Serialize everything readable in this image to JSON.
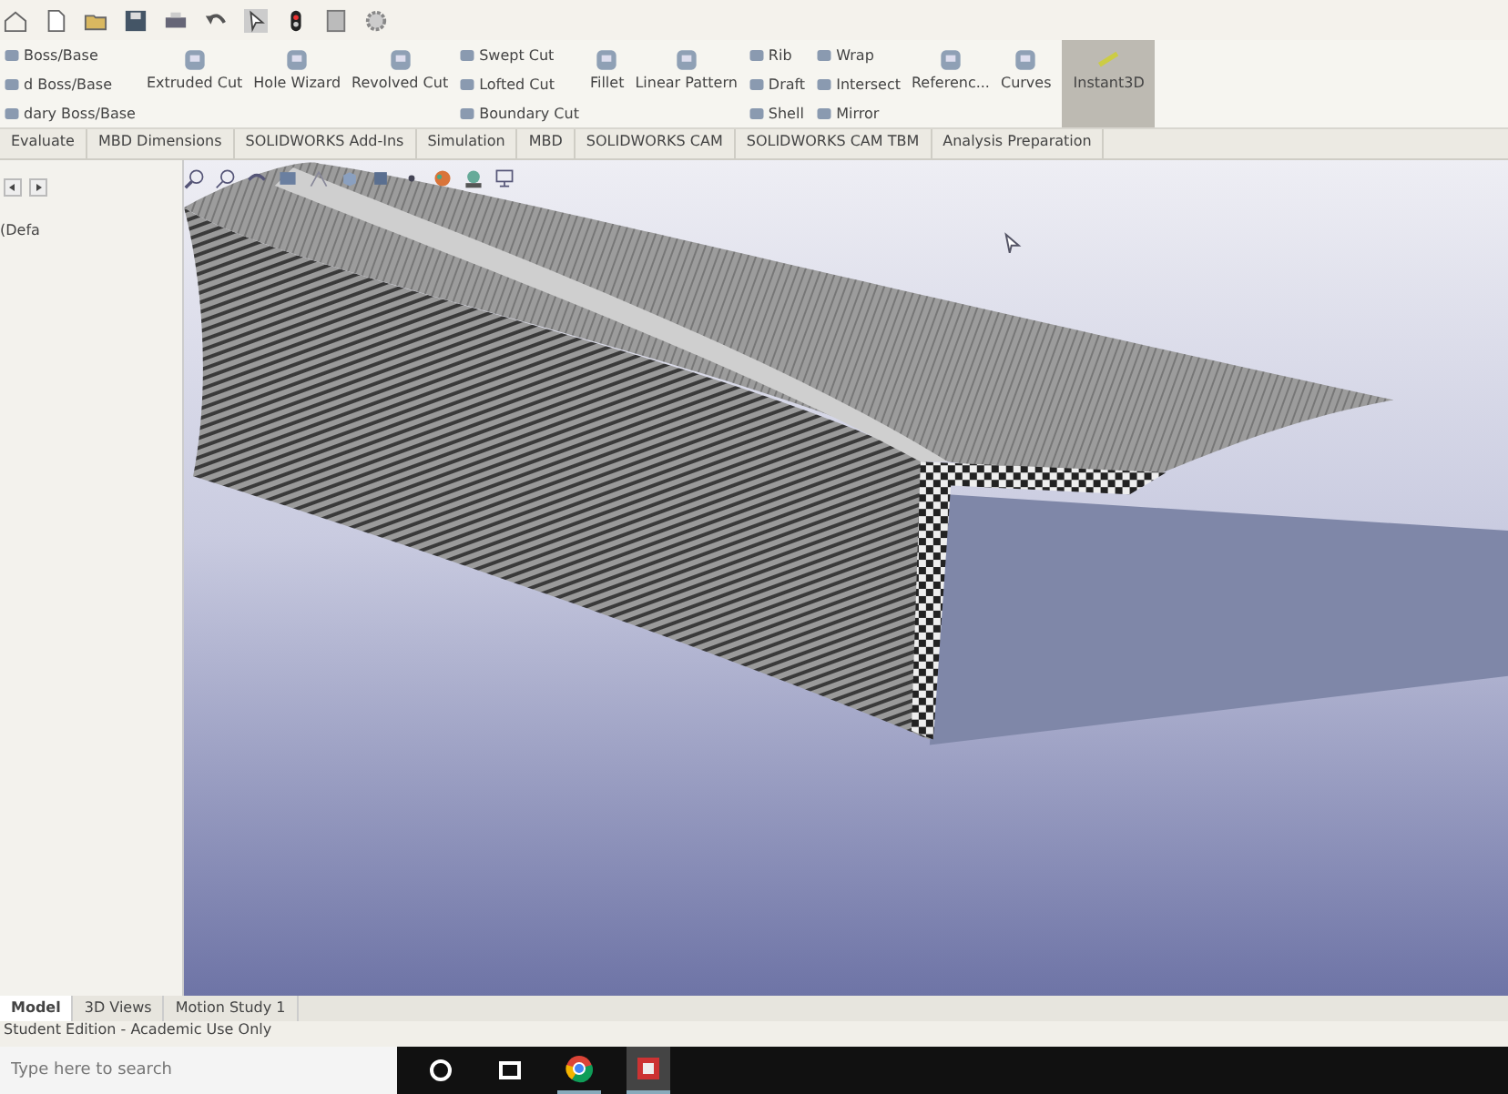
{
  "ribbon": {
    "instant3d": {
      "label": "Instant3D",
      "on": true
    },
    "groups": [
      {
        "kind": "stack",
        "items": [
          "Boss/Base",
          "d Boss/Base",
          "dary Boss/Base"
        ]
      },
      {
        "kind": "large",
        "label": "Extruded Cut"
      },
      {
        "kind": "large",
        "label": "Hole Wizard"
      },
      {
        "kind": "large",
        "label": "Revolved Cut"
      },
      {
        "kind": "stack",
        "items": [
          "Swept Cut",
          "Lofted Cut",
          "Boundary Cut"
        ]
      },
      {
        "kind": "large",
        "label": "Fillet"
      },
      {
        "kind": "large",
        "label": "Linear Pattern"
      },
      {
        "kind": "stack",
        "items": [
          "Rib",
          "Draft",
          "Shell"
        ]
      },
      {
        "kind": "stack",
        "items": [
          "Wrap",
          "Intersect",
          "Mirror"
        ]
      },
      {
        "kind": "large",
        "label": "Referenc..."
      },
      {
        "kind": "large",
        "label": "Curves"
      }
    ]
  },
  "tabs": [
    {
      "label": "Evaluate",
      "selected": false
    },
    {
      "label": "MBD Dimensions",
      "selected": false
    },
    {
      "label": "SOLIDWORKS Add-Ins",
      "selected": false
    },
    {
      "label": "Simulation",
      "selected": false
    },
    {
      "label": "MBD",
      "selected": false
    },
    {
      "label": "SOLIDWORKS CAM",
      "selected": false
    },
    {
      "label": "SOLIDWORKS CAM TBM",
      "selected": false
    },
    {
      "label": "Analysis Preparation",
      "selected": false
    }
  ],
  "feature_tree": {
    "item": "(Defa"
  },
  "bottom_tabs": [
    {
      "label": "Model",
      "selected": true
    },
    {
      "label": "3D Views",
      "selected": false
    },
    {
      "label": "Motion Study 1",
      "selected": false
    }
  ],
  "status_bar": {
    "text": "Student Edition - Academic Use Only"
  },
  "taskbar": {
    "search": {
      "placeholder": "Type here to search"
    }
  }
}
